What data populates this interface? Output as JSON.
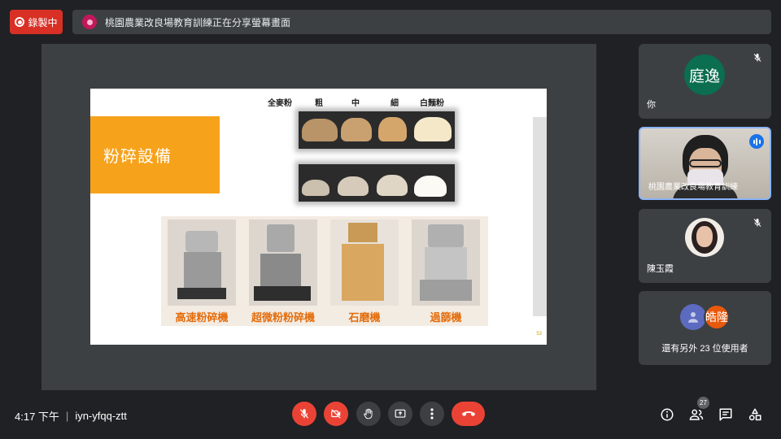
{
  "recording": {
    "label": "錄製中"
  },
  "share_banner": {
    "text": "桃園農業改良場教育訓練正在分享螢幕畫面"
  },
  "slide": {
    "title": "粉碎設備",
    "flour_labels": [
      "全麥粉",
      "粗",
      "中",
      "細",
      "白麵粉"
    ],
    "machines": [
      "高速粉碎機",
      "超微粉粉碎機",
      "石磨機",
      "過篩機"
    ],
    "page_number": "53"
  },
  "participants": {
    "me": {
      "initials": "庭逸",
      "name": "你",
      "avatar_color": "#0b6e4f"
    },
    "presenter": {
      "name": "桃園農業改良場教育訓練"
    },
    "third": {
      "name": "陳玉霞"
    },
    "others": {
      "avatar_initials": "皓隆",
      "avatar_color": "#e8590c",
      "label": "還有另外 23 位使用者"
    }
  },
  "bottom_bar": {
    "time": "4:17 下午",
    "separator": "|",
    "meeting_code": "iyn-yfqq-ztt",
    "people_count": "27"
  },
  "colors": {
    "accent_red": "#ea4335",
    "slide_orange": "#f7a21b",
    "machine_label": "#e46c0a"
  },
  "icons": [
    "record-icon",
    "mic-off-icon",
    "camera-off-icon",
    "raise-hand-icon",
    "present-icon",
    "more-icon",
    "end-call-icon",
    "info-icon",
    "people-icon",
    "chat-icon",
    "activities-icon",
    "speaking-icon"
  ]
}
